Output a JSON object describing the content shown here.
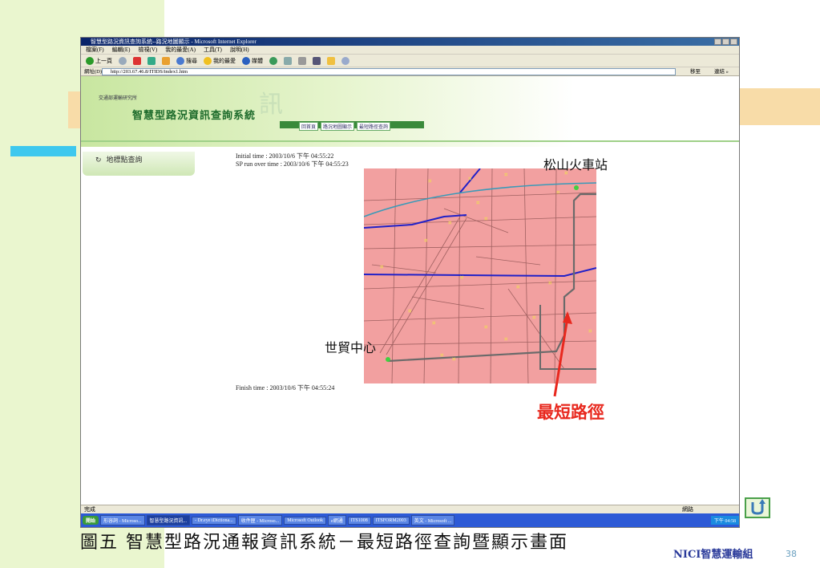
{
  "window": {
    "title": "智慧型路況資訊查詢系統--路況地圖顯示 - Microsoft Internet Explorer",
    "menu": [
      "檔案(F)",
      "編輯(E)",
      "檢視(V)",
      "我的最愛(A)",
      "工具(T)",
      "說明(H)"
    ],
    "toolbar": {
      "back": "上一頁",
      "search": "搜尋",
      "favorites": "我的最愛",
      "media": "媒體"
    },
    "address_label": "網址(D)",
    "address_value": "http://203.67.46.8/ITIDS/index1.htm",
    "go_label": "移至",
    "links_label": "連結 »"
  },
  "banner": {
    "org": "交通部運輸研究所",
    "system_title": "智慧型路況資訊查詢系統",
    "watermark": "訊",
    "nav": [
      "回首頁",
      "路況地圖顯示",
      "最短路徑查詢"
    ]
  },
  "sidebar": {
    "landmark_query": "地標點查詢"
  },
  "times": {
    "initial": "Initial time : 2003/10/6 下午 04:55:22",
    "sp_run_over": "SP run over time : 2003/10/6 下午 04:55:23",
    "finish": "Finish time : 2003/10/6 下午 04:55:24"
  },
  "map": {
    "label_start": "松山火車站",
    "label_end": "世貿中心",
    "label_route": "最短路徑",
    "route_color": "#e8281e"
  },
  "statusbar": {
    "text": "完成",
    "zone": "網路"
  },
  "taskbar": {
    "start": "開始",
    "tasks": [
      "形容詞 - Microso...",
      "智慧型路況資訊...",
      "- Dr.eye iDictiona...",
      "收件匣 - Microso...",
      "Microsoft Outlook",
      "e網通",
      "ITS1008",
      "ITSFORM2003",
      "英文 - Microsoft ..."
    ],
    "clock": "下午 04:58"
  },
  "slide": {
    "caption": "圖五   智慧型路況通報資訊系統－最短路徑查詢暨顯示畫面",
    "footer": "NICI智慧運輸組",
    "page_number": "38"
  },
  "colors": {
    "page_bg_green": "#eaf6cf",
    "accent_orange": "#f8dca8",
    "accent_cyan": "#3ec8ee",
    "map_bg": "#f2a0a0"
  }
}
